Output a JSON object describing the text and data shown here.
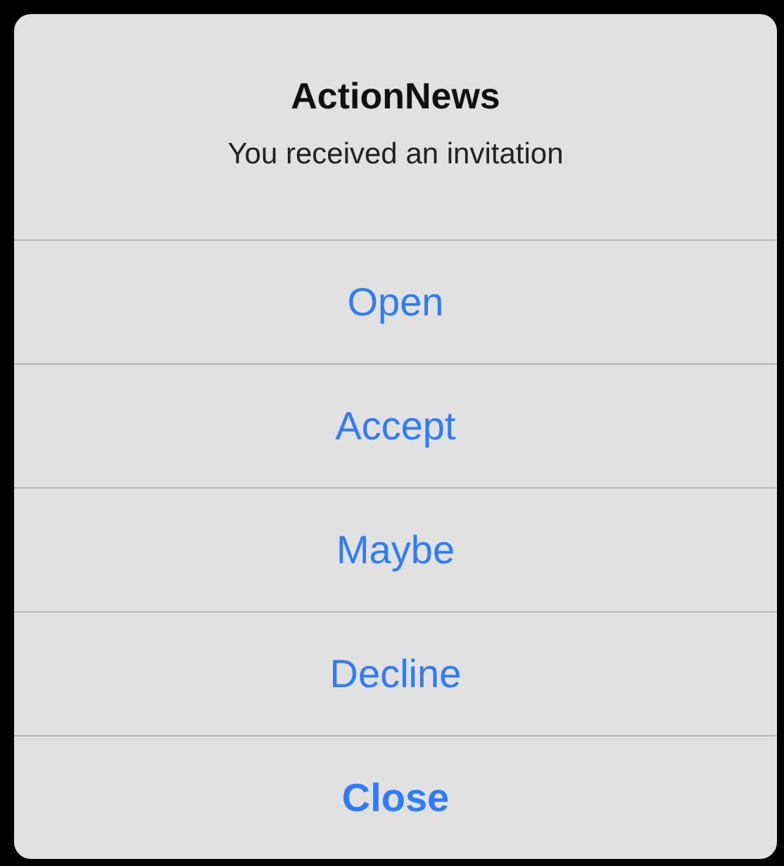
{
  "alert": {
    "title": "ActionNews",
    "message": "You received an invitation",
    "buttons": [
      {
        "label": "Open",
        "kind": "default"
      },
      {
        "label": "Accept",
        "kind": "default"
      },
      {
        "label": "Maybe",
        "kind": "default"
      },
      {
        "label": "Decline",
        "kind": "default"
      },
      {
        "label": "Close",
        "kind": "preferred"
      }
    ]
  }
}
